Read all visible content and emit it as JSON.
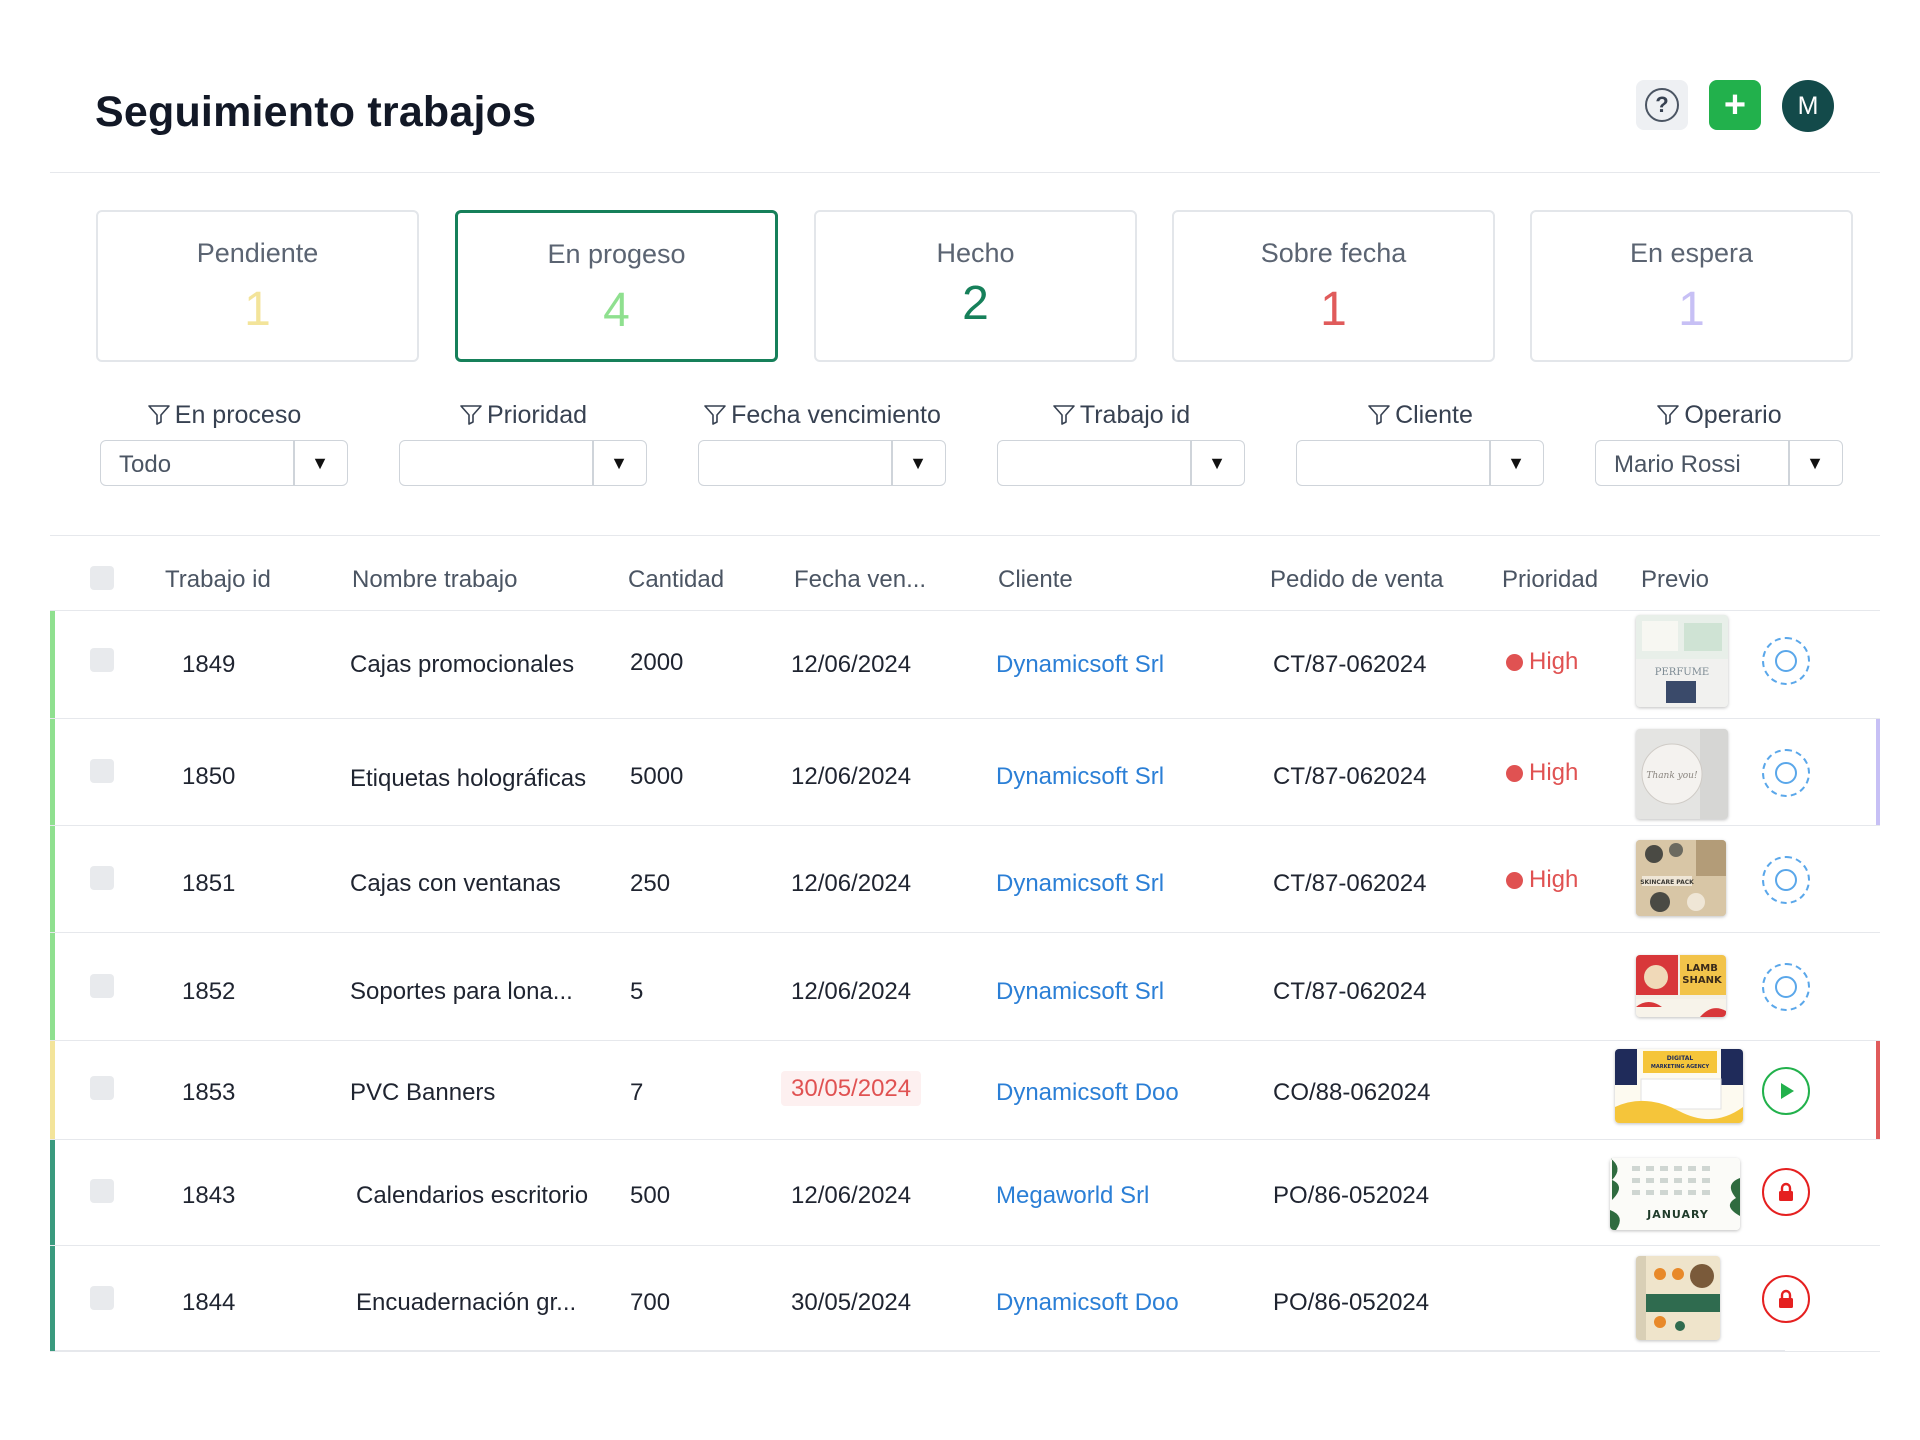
{
  "header": {
    "title": "Seguimiento trabajos",
    "help_icon": "help-circle-icon",
    "help_symbol": "?",
    "add_icon": "plus-icon",
    "add_symbol": "+",
    "avatar_initial": "M"
  },
  "status_cards": [
    {
      "label": "Pendiente",
      "count": "1",
      "color": "#f3e49a"
    },
    {
      "label": "En progeso",
      "count": "4",
      "color": "#8fe08f",
      "active": true
    },
    {
      "label": "Hecho",
      "count": "2",
      "color": "#16805a"
    },
    {
      "label": "Sobre fecha",
      "count": "1",
      "color": "#e05b5b"
    },
    {
      "label": "En espera",
      "count": "1",
      "color": "#c7c0f5"
    }
  ],
  "filters": [
    {
      "label": "En proceso",
      "value": "Todo"
    },
    {
      "label": "Prioridad",
      "value": ""
    },
    {
      "label": "Fecha vencimiento",
      "value": ""
    },
    {
      "label": "Trabajo id",
      "value": ""
    },
    {
      "label": "Cliente",
      "value": ""
    },
    {
      "label": "Operario",
      "value": "Mario Rossi"
    }
  ],
  "table": {
    "columns": [
      "Trabajo id",
      "Nombre trabajo",
      "Cantidad",
      "Fecha ven...",
      "Cliente",
      "Pedido de venta",
      "Prioridad",
      "Previo"
    ],
    "rows": [
      {
        "id": "1849",
        "name": "Cajas promocionales",
        "qty": "2000",
        "date": "12/06/2024",
        "client": "Dynamicsoft Srl",
        "order": "CT/87-062024",
        "priority": "High",
        "action": "clock-icon",
        "stripe": "#8fe08f"
      },
      {
        "id": "1850",
        "name": "Etiquetas holográficas",
        "qty": "5000",
        "date": "12/06/2024",
        "client": "Dynamicsoft Srl",
        "order": "CT/87-062024",
        "priority": "High",
        "action": "clock-icon",
        "stripe": "#8fe08f",
        "right_stripe": "#c7c0f5"
      },
      {
        "id": "1851",
        "name": "Cajas con ventanas",
        "qty": "250",
        "date": "12/06/2024",
        "client": "Dynamicsoft Srl",
        "order": "CT/87-062024",
        "priority": "High",
        "action": "clock-icon",
        "stripe": "#8fe08f"
      },
      {
        "id": "1852",
        "name": "Soportes para lona...",
        "qty": "5",
        "date": "12/06/2024",
        "client": "Dynamicsoft Srl",
        "order": "CT/87-062024",
        "priority": "",
        "action": "clock-icon",
        "stripe": "#8fe08f"
      },
      {
        "id": "1853",
        "name": "PVC Banners",
        "qty": "7",
        "date": "30/05/2024",
        "date_overdue": true,
        "client": "Dynamicsoft Doo",
        "order": "CO/88-062024",
        "priority": "",
        "action": "play-icon",
        "stripe": "#f3e49a",
        "right_stripe": "#e05b5b"
      },
      {
        "id": "1843",
        "name": "Calendarios escritorio",
        "qty": "500",
        "date": "12/06/2024",
        "client": "Megaworld Srl",
        "order": "PO/86-052024",
        "priority": "",
        "action": "lock-icon",
        "stripe": "#3a9a7e"
      },
      {
        "id": "1844",
        "name": "Encuadernación gr...",
        "qty": "700",
        "date": "30/05/2024",
        "client": "Dynamicsoft Doo",
        "order": "PO/86-052024",
        "priority": "",
        "action": "lock-icon",
        "stripe": "#3a9a7e"
      }
    ]
  },
  "thumbnails": {
    "t1849": [
      "PERFUME"
    ],
    "t1850": [
      "Thank you!"
    ],
    "t1851": [
      "SKINCARE PACK"
    ],
    "t1852": [
      "LAMB",
      "SHANK"
    ],
    "t1853": [
      "DIGITAL",
      "MARKETING AGENCY"
    ],
    "t1843": [
      "JANUARY"
    ],
    "t1844": []
  }
}
